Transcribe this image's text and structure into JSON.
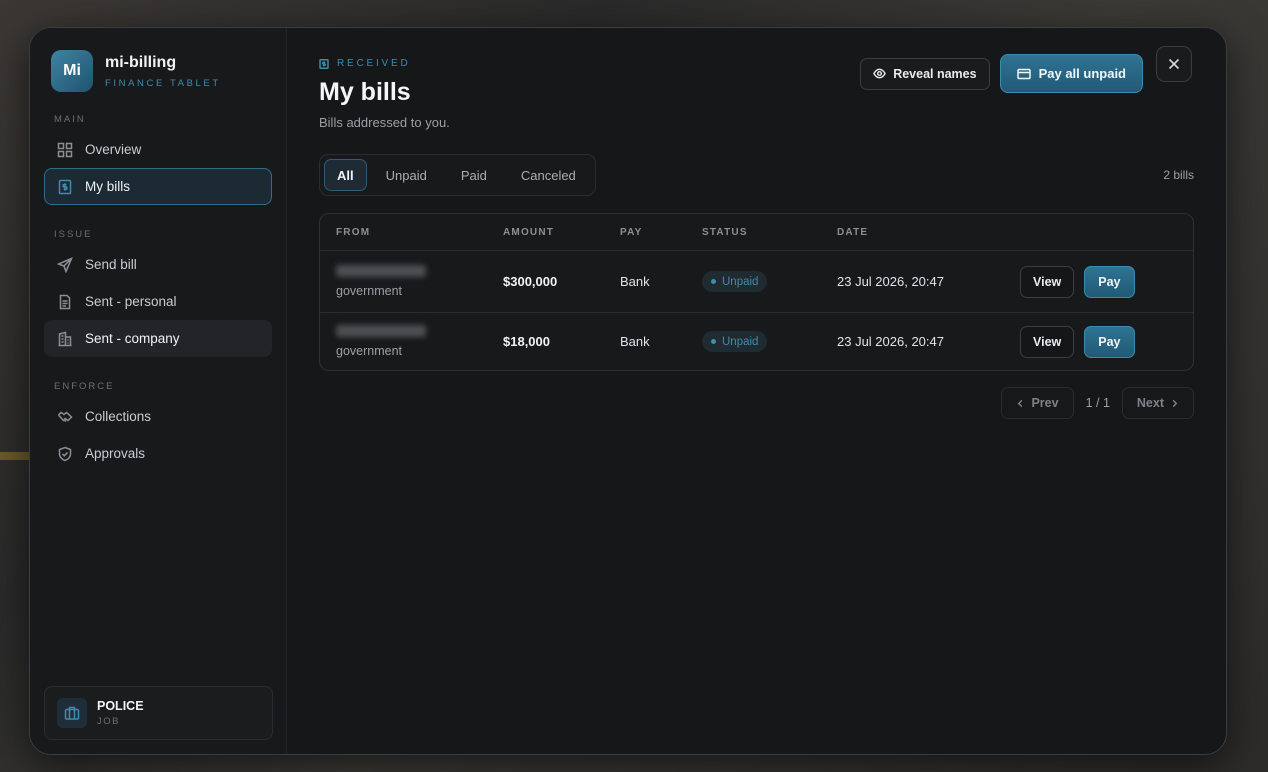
{
  "brand": {
    "logo": "Mi",
    "name": "mi-billing",
    "subtitle": "FINANCE TABLET"
  },
  "sidebar": {
    "sections": {
      "main": "MAIN",
      "issue": "ISSUE",
      "enforce": "ENFORCE"
    },
    "items": {
      "overview": "Overview",
      "my_bills": "My bills",
      "send_bill": "Send bill",
      "sent_personal": "Sent - personal",
      "sent_company": "Sent - company",
      "collections": "Collections",
      "approvals": "Approvals"
    },
    "active": "my_bills"
  },
  "job": {
    "name": "POLICE",
    "label": "JOB"
  },
  "header": {
    "eyebrow": "RECEIVED",
    "title": "My bills",
    "subtitle": "Bills addressed to you.",
    "reveal_label": "Reveal names",
    "pay_all_label": "Pay all unpaid"
  },
  "filters": {
    "tabs": [
      "All",
      "Unpaid",
      "Paid",
      "Canceled"
    ],
    "active": "All",
    "count": "2 bills"
  },
  "table": {
    "headers": {
      "from": "FROM",
      "amount": "AMOUNT",
      "pay": "PAY",
      "status": "STATUS",
      "date": "DATE"
    },
    "rows": [
      {
        "from_sub": "government",
        "amount": "$300,000",
        "pay": "Bank",
        "status": "Unpaid",
        "date": "23 Jul 2026, 20:47",
        "view": "View",
        "pay_btn": "Pay"
      },
      {
        "from_sub": "government",
        "amount": "$18,000",
        "pay": "Bank",
        "status": "Unpaid",
        "date": "23 Jul 2026, 20:47",
        "view": "View",
        "pay_btn": "Pay"
      }
    ]
  },
  "pagination": {
    "prev": "Prev",
    "info": "1 / 1",
    "next": "Next"
  },
  "colors": {
    "accent": "#3f8cae",
    "primary_button": "#2a6888",
    "panel": "#161719"
  }
}
